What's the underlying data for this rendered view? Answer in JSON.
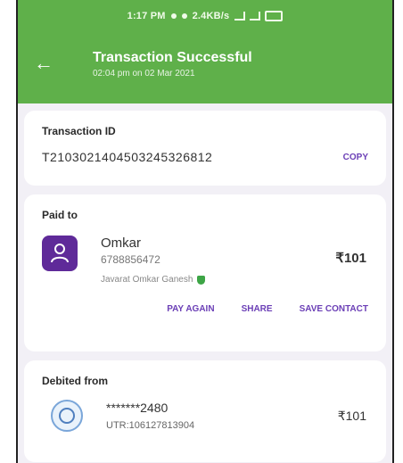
{
  "status_bar": {
    "time": "1:17 PM",
    "net_speed": "2.4KB/s"
  },
  "header": {
    "title": "Transaction Successful",
    "subtitle": "02:04 pm on 02 Mar 2021"
  },
  "transaction": {
    "label": "Transaction ID",
    "id": "T2103021404503245326812",
    "copy_label": "COPY"
  },
  "paid_to": {
    "label": "Paid to",
    "name": "Omkar",
    "phone": "6788856472",
    "legal_name": "Javarat Omkar Ganesh",
    "amount": "₹101",
    "actions": {
      "pay_again": "PAY AGAIN",
      "share": "SHARE",
      "save_contact": "SAVE CONTACT"
    }
  },
  "debited_from": {
    "label": "Debited from",
    "account": "*******2480",
    "utr": "UTR:106127813904",
    "amount": "₹101"
  },
  "colors": {
    "header_green": "#5fb04a",
    "accent_purple": "#6b3fb6",
    "avatar_purple": "#5f2a99",
    "verified_green": "#3da546"
  }
}
